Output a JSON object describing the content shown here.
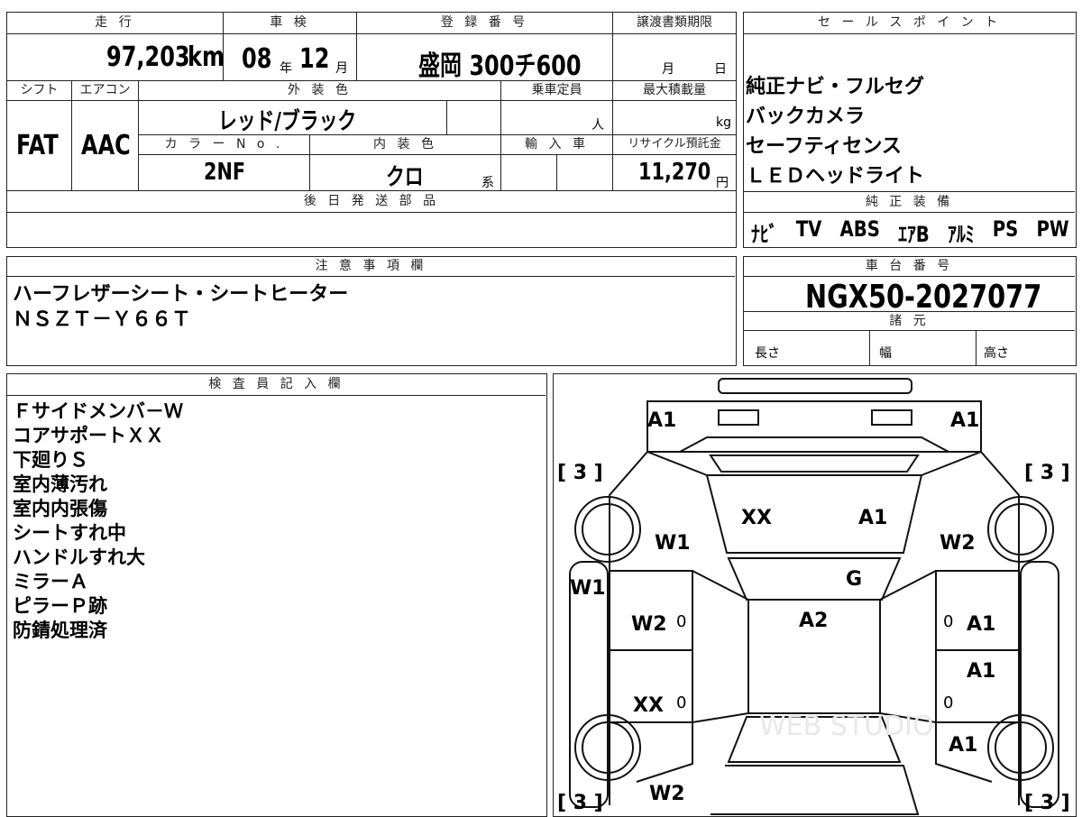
{
  "row1": {
    "mileage_header": "走 行",
    "mileage_value": "97,203",
    "mileage_unit": "km",
    "inspection_header": "車 検",
    "inspection_year": "08",
    "inspection_year_unit": "年",
    "inspection_month": "12",
    "inspection_month_unit": "月",
    "registration_header": "登 録 番 号",
    "registration_value": "盛岡 300チ600",
    "transfer_header": "譲渡書類期限",
    "transfer_month_unit": "月",
    "transfer_day_unit": "日"
  },
  "row2": {
    "shift_header": "シフト",
    "shift_value": "FAT",
    "ac_header": "エアコン",
    "ac_value": "AAC",
    "exterior_header": "外 装 色",
    "exterior_value": "レッド/ブラック",
    "capacity_header": "乗車定員",
    "capacity_unit": "人",
    "load_header": "最大積載量",
    "load_unit": "kg",
    "color_no_header": "カ ラ ー N o .",
    "color_no_value": "2NF",
    "interior_header": "内 装 色",
    "interior_value": "クロ",
    "interior_suffix": "系",
    "import_header": "輸 入 車",
    "recycle_header": "リサイクル預託金",
    "recycle_value": "11,270",
    "recycle_unit": "円"
  },
  "later_parts_header": "後 日 発 送 部 品",
  "sale_points": {
    "header": "セ ー ル ス ポ イ ン ト",
    "items": [
      "純正ナビ・フルセグ",
      "バックカメラ",
      "セーフティセンス",
      "ＬＥＤヘッドライト"
    ]
  },
  "equipment": {
    "header": "純 正 装 備",
    "items": [
      "ﾅﾋﾞ",
      "TV",
      "ABS",
      "ｴｱB",
      "ｱﾙﾐ",
      "PS",
      "PW"
    ]
  },
  "notes": {
    "header": "注 意 事 項 欄",
    "lines": [
      "ハーフレザーシート・シートヒーター",
      "ＮＳＺＴ－Ｙ６６Ｔ"
    ]
  },
  "chassis": {
    "header": "車 台 番 号",
    "value": "NGX50-2027077",
    "specs_header": "諸 元",
    "length_label": "長さ",
    "width_label": "幅",
    "height_label": "高さ"
  },
  "inspector": {
    "header": "検 査 員 記 入 欄",
    "lines": [
      "Ｆサイドメンバ－Ｗ",
      "コアサポートＸＸ",
      "下廻りＳ",
      "室内薄汚れ",
      "室内内張傷",
      "シートすれ中",
      "ハンドルすれ大",
      "ミラーＡ",
      "ピラーＰ跡",
      "防錆処理済"
    ]
  },
  "diagram": {
    "tire_labels": [
      "[ 3 ]",
      "[ 3 ]",
      "[ 3 ]",
      "[ 3 ]"
    ],
    "marks": {
      "front_left_corner": "A1",
      "front_right_corner": "A1",
      "hood_left": "XX",
      "hood_right": "A1",
      "front_left_fender": "W1",
      "front_right_fender": "W2",
      "left_side": "W1",
      "windshield": "G",
      "left_front_door": "W2",
      "roof": "A2",
      "right_front_door": "A1",
      "right_rear_door": "A1",
      "left_rear_door": "XX",
      "right_rear_quarter": "A1",
      "rear_left": "W2",
      "zero_a": "0",
      "zero_b": "0",
      "zero_c": "0",
      "zero_d": "0"
    },
    "watermark": "WEB STUDIO"
  }
}
